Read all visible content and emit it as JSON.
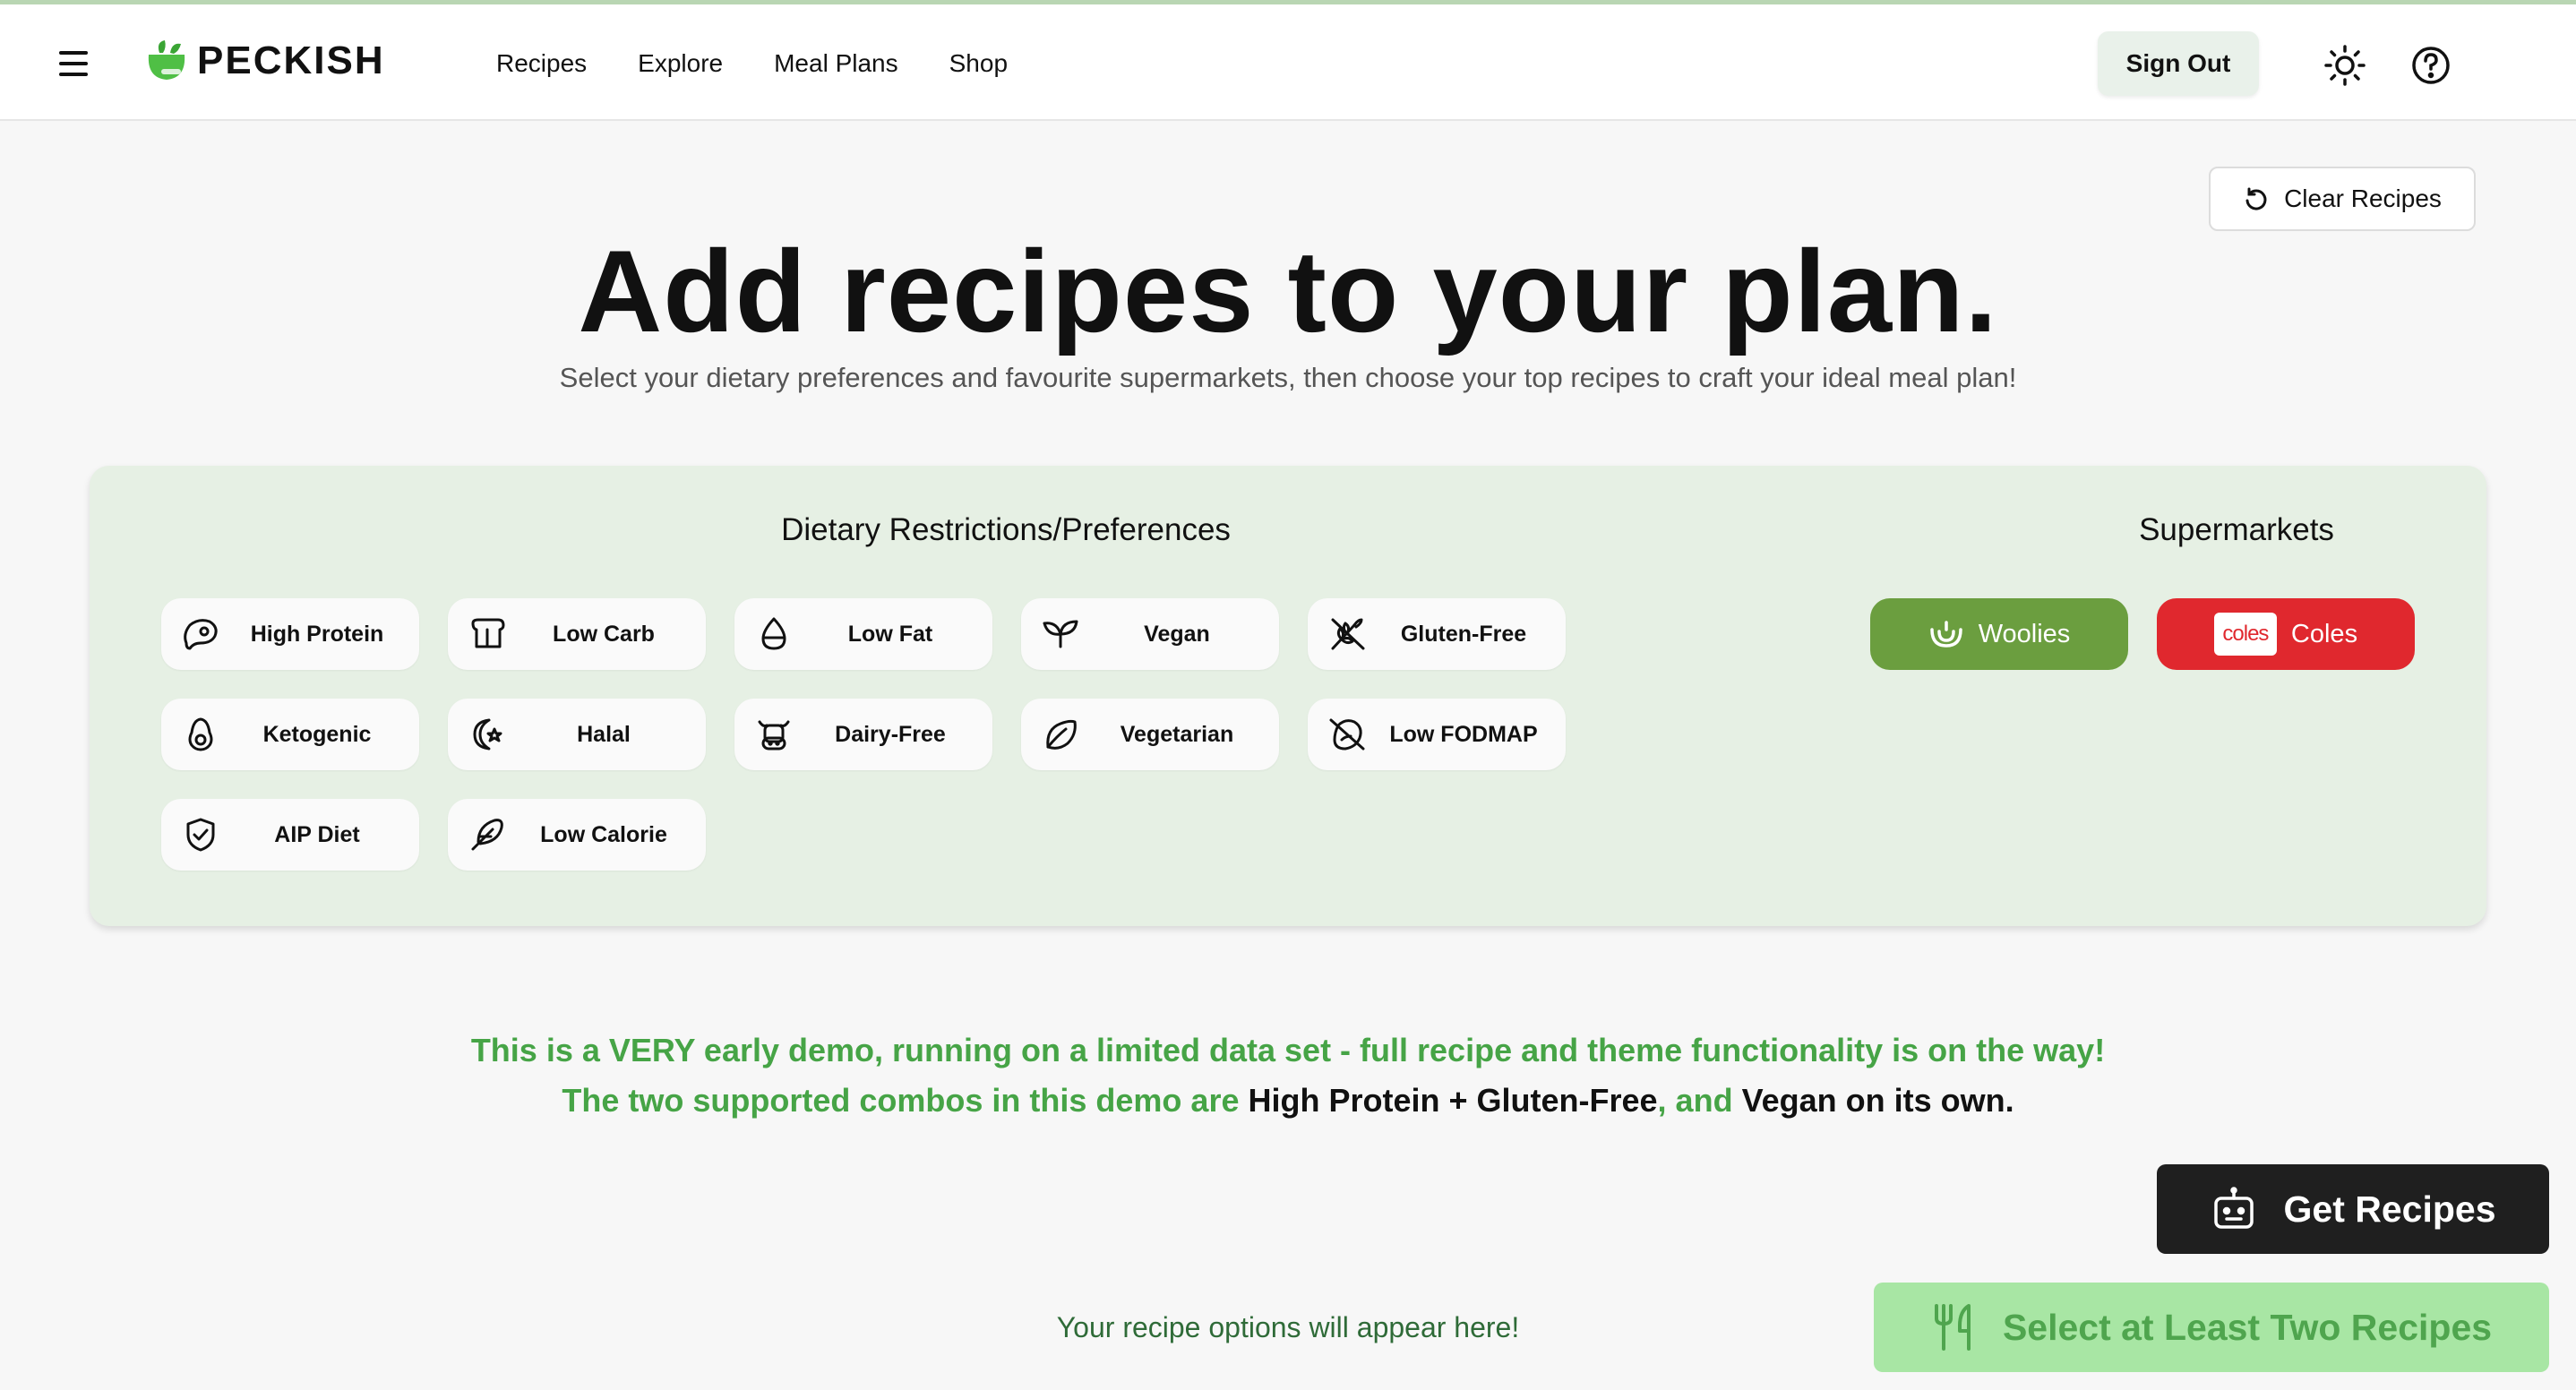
{
  "app": {
    "name": "PECKISH"
  },
  "nav": {
    "items": [
      "Recipes",
      "Explore",
      "Meal Plans",
      "Shop"
    ]
  },
  "header": {
    "signout_label": "Sign Out",
    "icons": [
      "menu-icon",
      "sun-icon",
      "help-icon"
    ]
  },
  "main": {
    "clear_label": "Clear Recipes",
    "title": "Add recipes to your plan.",
    "subtitle": "Select your dietary preferences and favourite supermarkets, then choose your top recipes to craft your ideal meal plan!"
  },
  "dietary": {
    "heading": "Dietary Restrictions/Preferences",
    "options": [
      {
        "label": "High Protein",
        "icon": "steak-icon"
      },
      {
        "label": "Low Carb",
        "icon": "bread-icon"
      },
      {
        "label": "Low Fat",
        "icon": "droplet-icon"
      },
      {
        "label": "Vegan",
        "icon": "sprout-icon"
      },
      {
        "label": "Gluten-Free",
        "icon": "wheat-off-icon"
      },
      {
        "label": "Ketogenic",
        "icon": "avocado-icon"
      },
      {
        "label": "Halal",
        "icon": "crescent-star-icon"
      },
      {
        "label": "Dairy-Free",
        "icon": "cow-icon"
      },
      {
        "label": "Vegetarian",
        "icon": "leaf-icon"
      },
      {
        "label": "Low FODMAP",
        "icon": "bean-off-icon"
      },
      {
        "label": "AIP Diet",
        "icon": "shield-check-icon"
      },
      {
        "label": "Low Calorie",
        "icon": "feather-icon"
      }
    ]
  },
  "supermarkets": {
    "heading": "Supermarkets",
    "woolies": {
      "label": "Woolies",
      "color": "#6b9e3f"
    },
    "coles": {
      "label": "Coles",
      "logo_text": "coles",
      "color": "#e0282e"
    }
  },
  "demo_notice": {
    "line1": "This is a VERY early demo, running on a limited data set - full recipe and theme functionality is on the way!",
    "line2_prefix": "The two supported combos in this demo are ",
    "combo1": "High Protein + Gluten-Free",
    "line2_mid": ", and ",
    "combo2": "Vegan on its own."
  },
  "actions": {
    "get_recipes": "Get Recipes",
    "select_two": "Select at Least Two Recipes",
    "placeholder": "Your recipe options will appear here!"
  }
}
